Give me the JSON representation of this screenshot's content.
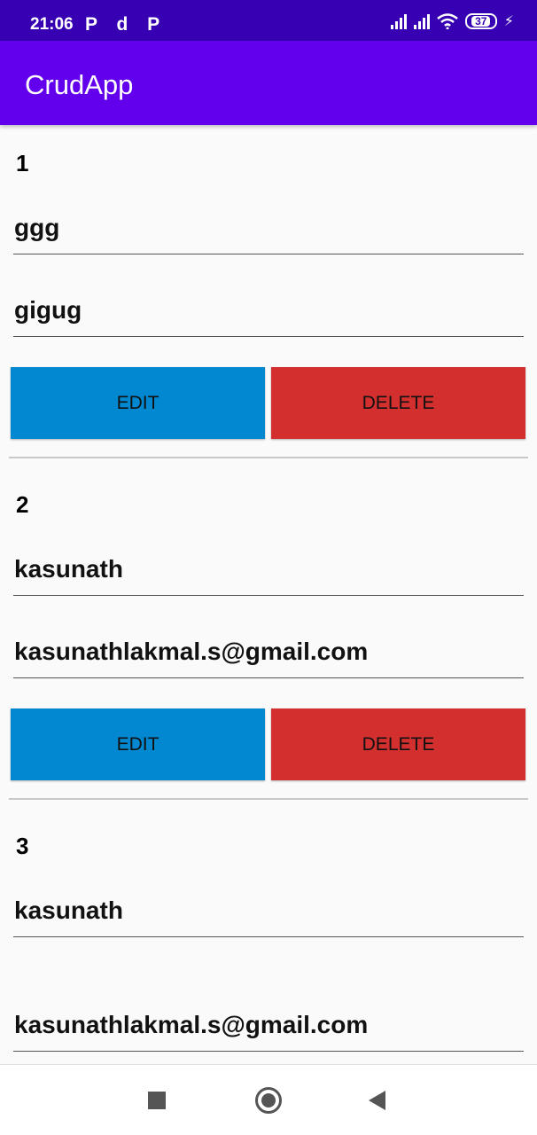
{
  "status_bar": {
    "time": "21:06",
    "notifications": "P d P",
    "battery": "37",
    "bolt": "⚡"
  },
  "app_bar": {
    "title": "CrudApp"
  },
  "records": [
    {
      "id": "1",
      "name": "ggg",
      "email": "gigug",
      "edit_label": "EDIT",
      "delete_label": "DELETE"
    },
    {
      "id": "2",
      "name": "kasunath",
      "email": "kasunathlakmal.s@gmail.com",
      "edit_label": "EDIT",
      "delete_label": "DELETE"
    },
    {
      "id": "3",
      "name": "kasunath",
      "email": "kasunathlakmal.s@gmail.com"
    }
  ],
  "colors": {
    "status_bar": "#3700b3",
    "app_bar": "#6200ee",
    "edit_button": "#0288d1",
    "delete_button": "#d32f2f"
  },
  "nav_icons": [
    "recent-apps-icon",
    "home-icon",
    "back-icon"
  ]
}
